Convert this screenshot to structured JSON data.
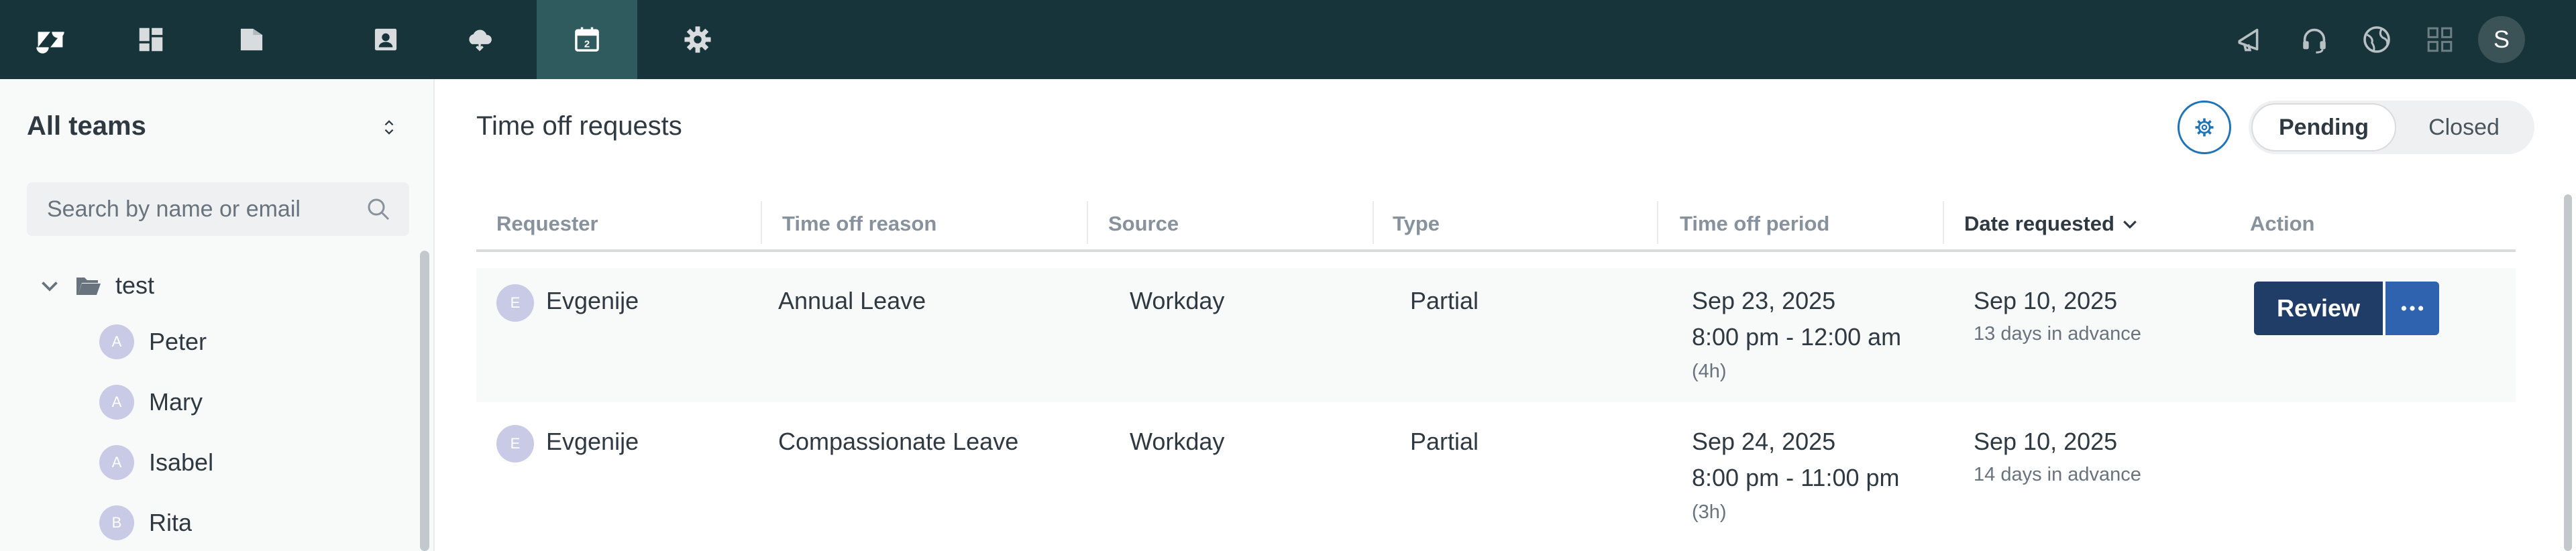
{
  "topnav": {
    "items": [
      {
        "name": "zendesk-logo-icon"
      },
      {
        "name": "dashboard-icon"
      },
      {
        "name": "folder-icon"
      },
      {
        "name": "contact-book-icon"
      },
      {
        "name": "cloud-icon"
      },
      {
        "name": "calendar-icon",
        "active": true
      },
      {
        "name": "settings-gear-icon"
      }
    ],
    "right_icons": [
      "megaphone-icon",
      "headset-icon",
      "globe-icon",
      "apps-grid-icon"
    ],
    "user_initial": "S",
    "colors": {
      "bar": "#17343a",
      "active": "#2f5a5e"
    }
  },
  "sidebar": {
    "title": "All teams",
    "search_placeholder": "Search by name or email",
    "tree": {
      "root_label": "test",
      "members": [
        {
          "initial": "A",
          "name": "Peter"
        },
        {
          "initial": "A",
          "name": "Mary"
        },
        {
          "initial": "A",
          "name": "Isabel"
        },
        {
          "initial": "B",
          "name": "Rita"
        }
      ]
    }
  },
  "main": {
    "title": "Time off requests",
    "filter": {
      "pending": "Pending",
      "closed": "Closed",
      "selected": "Pending"
    },
    "columns": [
      "Requester",
      "Time off reason",
      "Source",
      "Type",
      "Time off period",
      "Date requested",
      "Action"
    ],
    "rows": [
      {
        "initial": "E",
        "requester": "Evgenije",
        "reason": "Annual Leave",
        "source": "Workday",
        "type": "Partial",
        "period_date": "Sep 23, 2025",
        "period_time": "8:00 pm - 12:00 am",
        "period_duration": "(4h)",
        "date_requested": "Sep 10, 2025",
        "advance": "13 days in advance",
        "action_label": "Review"
      },
      {
        "initial": "E",
        "requester": "Evgenije",
        "reason": "Compassionate Leave",
        "source": "Workday",
        "type": "Partial",
        "period_date": "Sep 24, 2025",
        "period_time": "8:00 pm - 11:00 pm",
        "period_duration": "(3h)",
        "date_requested": "Sep 10, 2025",
        "advance": "14 days in advance"
      }
    ],
    "colors": {
      "primary": "#1f3d67",
      "secondary": "#2f63b0",
      "accent": "#1f73b7"
    }
  }
}
